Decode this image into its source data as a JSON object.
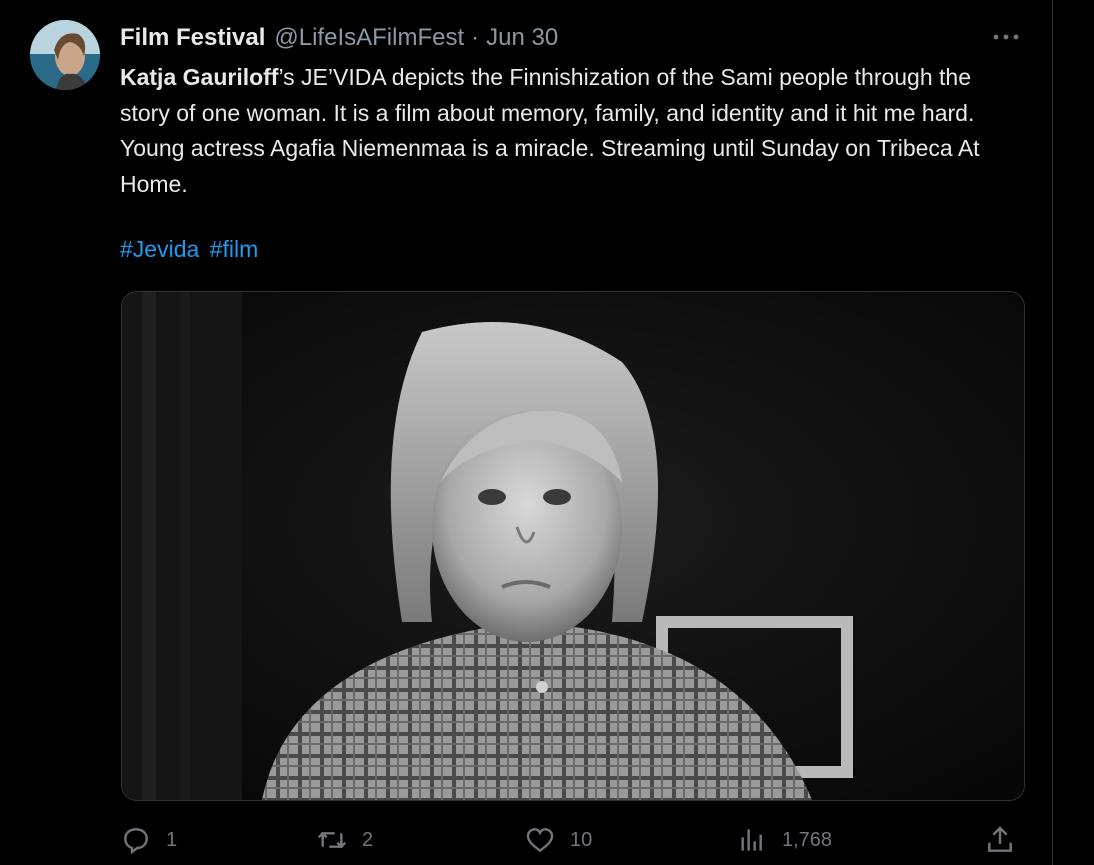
{
  "tweet": {
    "display_name": "Film Festival",
    "handle": "@LifeIsAFilmFest",
    "separator": "·",
    "date": "Jun 30",
    "text_bold": "Katja Gauriloff",
    "text_rest": "’s JE’VIDA depicts the Finnishization of the Sami people through the story of one woman. It is a film about memory, family, and identity and it hit me hard. Young actress Agafia Niemenmaa is a miracle. Streaming until Sunday on Tribeca At Home.",
    "hashtags": [
      "#Jevida",
      "#film"
    ]
  },
  "actions": {
    "reply_count": "1",
    "retweet_count": "2",
    "like_count": "10",
    "views_count": "1,768"
  },
  "icons": {
    "more": "more-horizontal-icon",
    "reply": "reply-icon",
    "retweet": "retweet-icon",
    "like": "heart-icon",
    "views": "analytics-icon",
    "share": "share-icon"
  },
  "colors": {
    "background": "#000000",
    "text": "#e7e9ea",
    "secondary": "#71767b",
    "link": "#1d9bf0",
    "border": "#2f3336"
  }
}
